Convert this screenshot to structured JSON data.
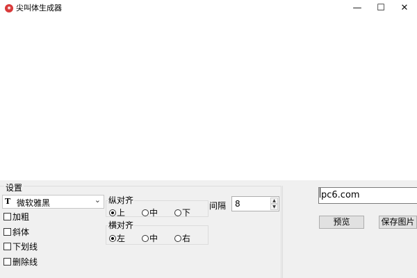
{
  "window": {
    "title": "尖叫体生成器",
    "icon": "app-logo-icon",
    "controls": {
      "minimize": "—",
      "maximize": "☐",
      "close": "✕"
    }
  },
  "settings": {
    "group_label": "设置",
    "font": {
      "value": "微软雅黑",
      "icon": "T"
    },
    "checkboxes": [
      {
        "label": "加粗",
        "checked": false
      },
      {
        "label": "斜体",
        "checked": false
      },
      {
        "label": "下划线",
        "checked": false
      },
      {
        "label": "删除线",
        "checked": false
      }
    ],
    "vertical_align": {
      "label": "纵对齐",
      "options": [
        {
          "label": "上",
          "selected": true
        },
        {
          "label": "中",
          "selected": false
        },
        {
          "label": "下",
          "selected": false
        }
      ]
    },
    "horizontal_align": {
      "label": "横对齐",
      "options": [
        {
          "label": "左",
          "selected": true
        },
        {
          "label": "中",
          "selected": false
        },
        {
          "label": "右",
          "selected": false
        }
      ]
    },
    "spacing": {
      "label": "间隔",
      "value": "8"
    }
  },
  "input": {
    "value": "pc6.com"
  },
  "buttons": {
    "preview": "预览",
    "save": "保存图片"
  }
}
